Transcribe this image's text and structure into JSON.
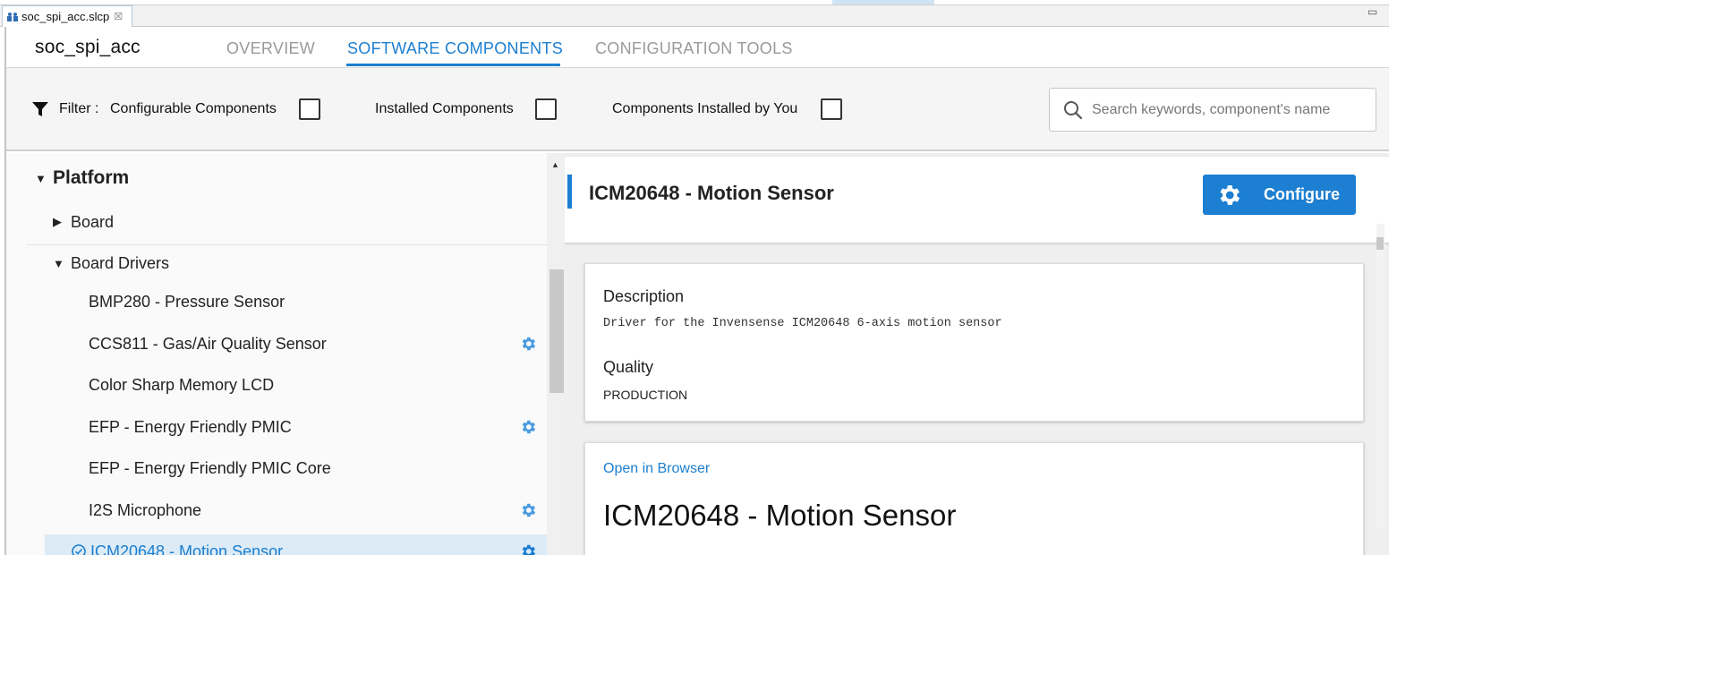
{
  "editor": {
    "tab_label": "soc_spi_acc.slcp",
    "close_glyph": "☒",
    "minimize_glyph": "▭",
    "maximize_glyph": "▭"
  },
  "header": {
    "project_name": "soc_spi_acc",
    "tabs": [
      {
        "label": "OVERVIEW",
        "active": false
      },
      {
        "label": "SOFTWARE COMPONENTS",
        "active": true
      },
      {
        "label": "CONFIGURATION TOOLS",
        "active": false
      }
    ],
    "accent_color": "#1c7fd1"
  },
  "filter": {
    "label": "Filter :",
    "options": [
      {
        "label": "Configurable Components",
        "checked": false
      },
      {
        "label": "Installed Components",
        "checked": false
      },
      {
        "label": "Components Installed by You",
        "checked": false
      }
    ],
    "search_placeholder": "Search keywords, component's name"
  },
  "tree": {
    "category": "Platform",
    "board": "Board",
    "group": "Board Drivers",
    "items": [
      {
        "label": "BMP280 - Pressure Sensor",
        "configurable": false
      },
      {
        "label": "CCS811 - Gas/Air Quality Sensor",
        "configurable": true
      },
      {
        "label": "Color Sharp Memory LCD",
        "configurable": false
      },
      {
        "label": "EFP - Energy Friendly PMIC",
        "configurable": true
      },
      {
        "label": "EFP - Energy Friendly PMIC Core",
        "configurable": false
      },
      {
        "label": "I2S Microphone",
        "configurable": true
      },
      {
        "label": "ICM20648 - Motion Sensor",
        "configurable": true,
        "selected": true,
        "installed": true
      }
    ]
  },
  "detail": {
    "title": "ICM20648 - Motion Sensor",
    "configure_label": "Configure",
    "description_label": "Description",
    "description_text": "Driver for the Invensense ICM20648 6-axis motion sensor",
    "quality_label": "Quality",
    "quality_value": "PRODUCTION",
    "open_in_browser": "Open in Browser",
    "doc_title": "ICM20648 - Motion Sensor"
  }
}
